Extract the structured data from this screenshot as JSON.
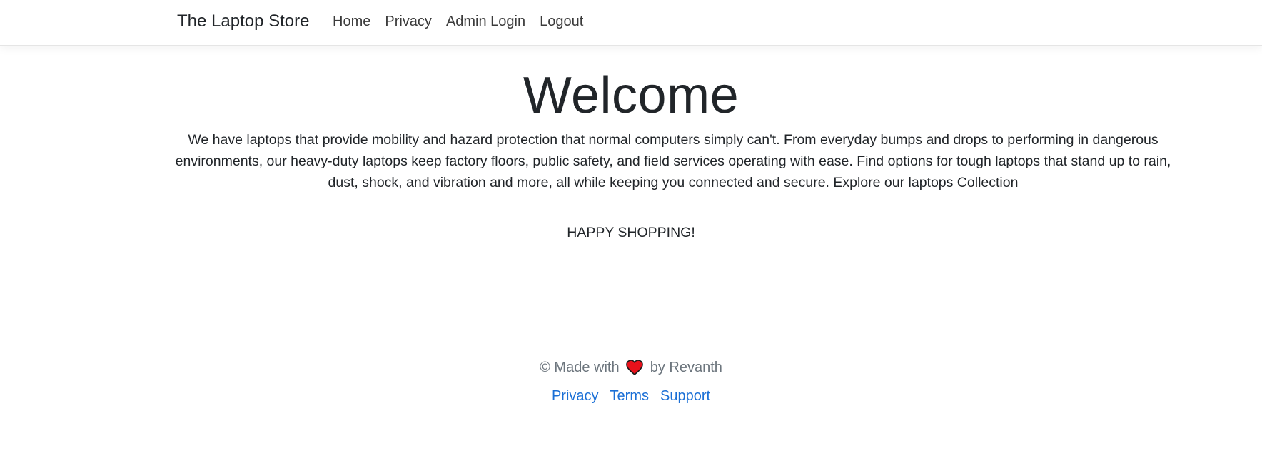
{
  "navbar": {
    "brand": "The Laptop Store",
    "links": [
      "Home",
      "Privacy",
      "Admin Login",
      "Logout"
    ]
  },
  "main": {
    "title": "Welcome",
    "intro": "We have laptops that provide mobility and hazard protection that normal computers simply can't. From everyday bumps and drops to performing in dangerous environments, our heavy-duty laptops keep factory floors, public safety, and field services operating with ease. Find options for tough laptops that stand up to rain, dust, shock, and vibration and more, all while keeping you connected and secure. Explore our laptops Collection",
    "tagline": "HAPPY SHOPPING!"
  },
  "footer": {
    "made_with_prefix": "© Made with",
    "made_with_suffix": "by Revanth",
    "heart_icon": "heart-icon",
    "links": [
      "Privacy",
      "Terms",
      "Support"
    ]
  },
  "colors": {
    "link": "#1a6fd6",
    "muted": "#6c757d",
    "heart": "#e8111b"
  }
}
